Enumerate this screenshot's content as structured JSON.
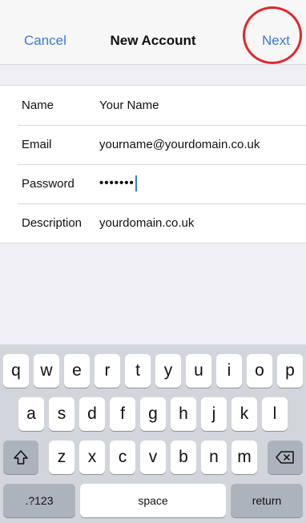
{
  "nav": {
    "cancel_label": "Cancel",
    "title": "New Account",
    "next_label": "Next"
  },
  "form": {
    "rows": [
      {
        "label": "Name",
        "value": "Your Name"
      },
      {
        "label": "Email",
        "value": "yourname@yourdomain.co.uk"
      },
      {
        "label": "Password",
        "value": "•••••••"
      },
      {
        "label": "Description",
        "value": "yourdomain.co.uk"
      }
    ]
  },
  "keyboard": {
    "row1": [
      "q",
      "w",
      "e",
      "r",
      "t",
      "y",
      "u",
      "i",
      "o",
      "p"
    ],
    "row2": [
      "a",
      "s",
      "d",
      "f",
      "g",
      "h",
      "j",
      "k",
      "l"
    ],
    "row3": [
      "z",
      "x",
      "c",
      "v",
      "b",
      "n",
      "m"
    ],
    "numbers_label": ".?123",
    "space_label": "space",
    "return_label": "return",
    "shift_icon": "shift-icon",
    "delete_icon": "backspace-icon"
  },
  "colors": {
    "accent": "#3a7bd5",
    "highlight_circle": "#e2262c"
  }
}
